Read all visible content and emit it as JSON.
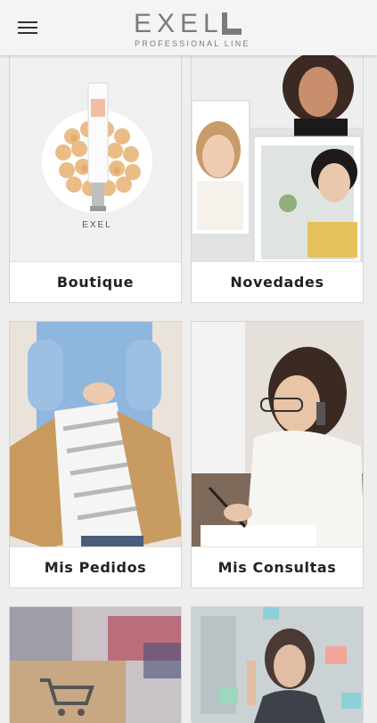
{
  "header": {
    "logo_word": "EXEL",
    "logo_sub": "PROFESSIONAL LINE"
  },
  "cards": [
    {
      "label": "Boutique"
    },
    {
      "label": "Novedades"
    },
    {
      "label": "Mis Pedidos"
    },
    {
      "label": "Mis Consultas"
    }
  ],
  "product_brand": "EXEL"
}
